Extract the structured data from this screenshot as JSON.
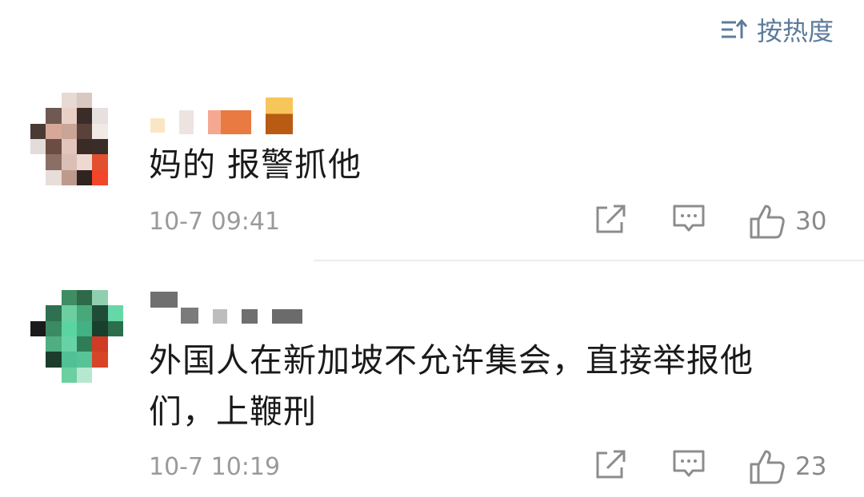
{
  "sort": {
    "label": "按热度",
    "icon": "sort-icon"
  },
  "comments": [
    {
      "text": "妈的 报警抓他",
      "time": "10-7 09:41",
      "likes": "30",
      "avatar_icon": "blurred-avatar",
      "actions": [
        "share-icon",
        "reply-icon",
        "like-icon"
      ]
    },
    {
      "text": "外国人在新加坡不允许集会，直接举报他们，上鞭刑",
      "time": "10-7 10:19",
      "likes": "23",
      "avatar_icon": "blurred-avatar",
      "actions": [
        "share-icon",
        "reply-icon",
        "like-icon"
      ]
    }
  ],
  "colors": {
    "accent": "#5d7b9c",
    "meta": "#9a9a9a",
    "text": "#1a1a1a",
    "divider": "#ececec"
  }
}
